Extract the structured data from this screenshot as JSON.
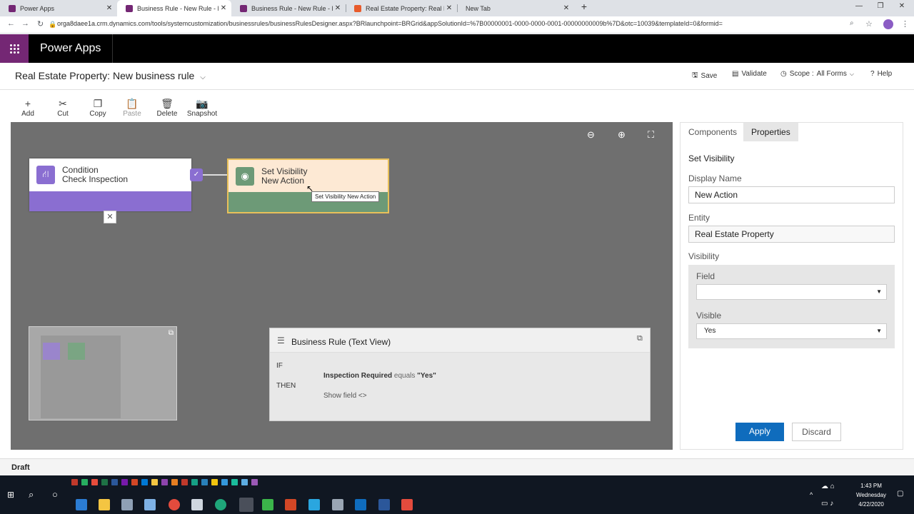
{
  "browser": {
    "tabs": [
      {
        "title": "Power Apps",
        "color": "#742774",
        "active": false
      },
      {
        "title": "Business Rule - New Rule - Micro",
        "color": "#742774",
        "active": true
      },
      {
        "title": "Business Rule - New Rule - Micro",
        "color": "#742774",
        "active": false
      },
      {
        "title": "Real Estate Property: Real Estate",
        "color": "#e85b2b",
        "active": false
      },
      {
        "title": "New Tab",
        "color": "",
        "active": false
      }
    ],
    "url": "orga8daee1a.crm.dynamics.com/tools/systemcustomization/businessrules/businessRulesDesigner.aspx?BRlaunchpoint=BRGrid&appSolutionId=%7B00000001-0000-0000-0001-00000000009b%7D&otc=10039&templateId=0&formid="
  },
  "app": {
    "title": "Power Apps",
    "accent": "#742774"
  },
  "rule": {
    "entity_prefix": "Real Estate Property:",
    "name": "New business rule",
    "commands": {
      "save": "Save",
      "validate": "Validate",
      "scope_label": "Scope :",
      "scope_value": "All Forms",
      "help": "Help"
    }
  },
  "toolbar": {
    "add": "Add",
    "cut": "Cut",
    "copy": "Copy",
    "paste": "Paste",
    "delete": "Delete",
    "snapshot": "Snapshot"
  },
  "canvas": {
    "condition": {
      "type": "Condition",
      "name": "Check Inspection",
      "color": "#8a6ed1"
    },
    "action": {
      "type": "Set Visibility",
      "name": "New Action",
      "color": "#6d9a77"
    },
    "tooltip": "Set Visibility New Action",
    "text_view": {
      "title": "Business Rule (Text View)",
      "if": "IF",
      "condition_field": "Inspection Required",
      "condition_op": "equals",
      "condition_value": "\"Yes\"",
      "then": "THEN",
      "action_text": "Show field <>"
    }
  },
  "panel": {
    "tabs": {
      "components": "Components",
      "properties": "Properties"
    },
    "heading": "Set Visibility",
    "display_name_label": "Display Name",
    "display_name_value": "New Action",
    "entity_label": "Entity",
    "entity_value": "Real Estate Property",
    "visibility_label": "Visibility",
    "field_label": "Field",
    "field_value": "",
    "visible_label": "Visible",
    "visible_value": "Yes",
    "apply": "Apply",
    "discard": "Discard",
    "apply_color": "#0f6cbd"
  },
  "status": {
    "state": "Draft"
  },
  "taskbar": {
    "time": "1:43 PM",
    "day": "Wednesday",
    "date": "4/22/2020"
  }
}
